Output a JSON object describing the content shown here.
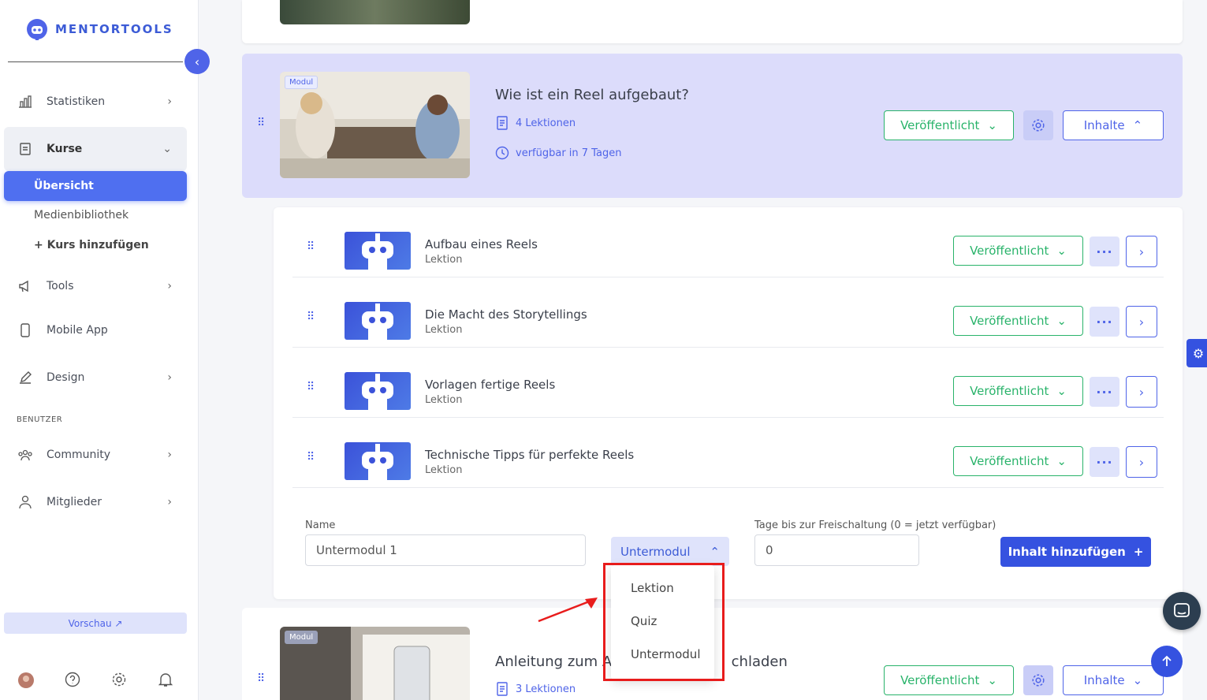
{
  "brand": {
    "name": "MENTORTOOLS",
    "accent": "#4f64e8"
  },
  "sidebar": {
    "items": [
      {
        "label": "Statistiken",
        "icon": "bar-chart-icon"
      },
      {
        "label": "Kurse",
        "icon": "book-icon"
      },
      {
        "label": "Tools",
        "icon": "megaphone-icon"
      },
      {
        "label": "Mobile App",
        "icon": "phone-icon"
      },
      {
        "label": "Design",
        "icon": "pencil-icon"
      },
      {
        "label": "Community",
        "icon": "users-icon"
      },
      {
        "label": "Mitglieder",
        "icon": "user-icon"
      }
    ],
    "sub_items": [
      "Übersicht",
      "Medienbibliothek",
      "+ Kurs hinzufügen"
    ],
    "section_label": "BENUTZER",
    "preview_label": "Vorschau ↗"
  },
  "module1": {
    "badge": "Modul",
    "title": "Wie ist ein Reel aufgebaut?",
    "lessons_count": "4 Lektionen",
    "availability": "verfügbar in 7 Tagen",
    "status": "Veröffentlicht",
    "content_label": "Inhalte"
  },
  "lessons": [
    {
      "title": "Aufbau eines Reels",
      "type": "Lektion",
      "status": "Veröffentlicht"
    },
    {
      "title": "Die Macht des Storytellings",
      "type": "Lektion",
      "status": "Veröffentlicht"
    },
    {
      "title": "Vorlagen fertige Reels",
      "type": "Lektion",
      "status": "Veröffentlicht"
    },
    {
      "title": "Technische Tipps für perfekte Reels",
      "type": "Lektion",
      "status": "Veröffentlicht"
    }
  ],
  "form": {
    "name_label": "Name",
    "name_value": "Untermodul 1",
    "type_value": "Untermodul",
    "days_label": "Tage bis zur Freischaltung (0 = jetzt verfügbar)",
    "days_value": "0",
    "add_button": "Inhalt hinzufügen"
  },
  "dropdown": {
    "options": [
      "Lektion",
      "Quiz",
      "Untermodul"
    ]
  },
  "module2": {
    "badge": "Modul",
    "title_left": "Anleitung zum Au",
    "title_right": "chladen",
    "lessons_count": "3 Lektionen",
    "status": "Veröffentlicht",
    "content_label": "Inhalte"
  }
}
